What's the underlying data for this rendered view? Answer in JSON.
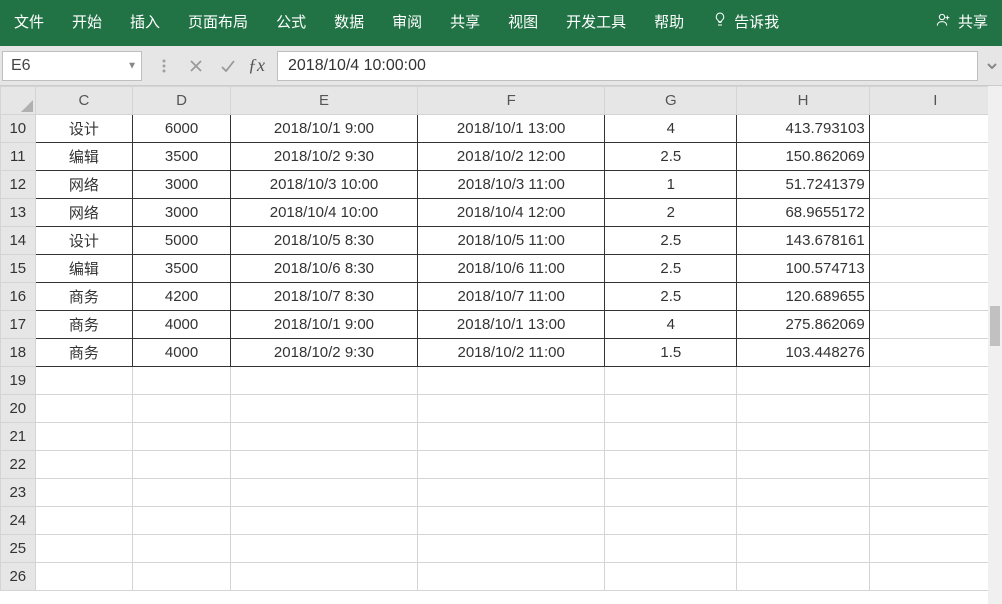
{
  "ribbon": {
    "tabs": [
      "文件",
      "开始",
      "插入",
      "页面布局",
      "公式",
      "数据",
      "审阅",
      "共享",
      "视图",
      "开发工具",
      "帮助"
    ],
    "tell_me": "告诉我",
    "share": "共享"
  },
  "formula_bar": {
    "name_box": "E6",
    "formula": "2018/10/4  10:00:00"
  },
  "columns": [
    "C",
    "D",
    "E",
    "F",
    "G",
    "H",
    "I"
  ],
  "row_start": 10,
  "total_rows": 17,
  "data_rows": 9,
  "cells": {
    "r0": {
      "C": "设计",
      "D": "6000",
      "E": "2018/10/1 9:00",
      "F": "2018/10/1 13:00",
      "G": "4",
      "H": "413.793103"
    },
    "r1": {
      "C": "编辑",
      "D": "3500",
      "E": "2018/10/2 9:30",
      "F": "2018/10/2 12:00",
      "G": "2.5",
      "H": "150.862069"
    },
    "r2": {
      "C": "网络",
      "D": "3000",
      "E": "2018/10/3 10:00",
      "F": "2018/10/3 11:00",
      "G": "1",
      "H": "51.7241379"
    },
    "r3": {
      "C": "网络",
      "D": "3000",
      "E": "2018/10/4 10:00",
      "F": "2018/10/4 12:00",
      "G": "2",
      "H": "68.9655172"
    },
    "r4": {
      "C": "设计",
      "D": "5000",
      "E": "2018/10/5 8:30",
      "F": "2018/10/5 11:00",
      "G": "2.5",
      "H": "143.678161"
    },
    "r5": {
      "C": "编辑",
      "D": "3500",
      "E": "2018/10/6 8:30",
      "F": "2018/10/6 11:00",
      "G": "2.5",
      "H": "100.574713"
    },
    "r6": {
      "C": "商务",
      "D": "4200",
      "E": "2018/10/7 8:30",
      "F": "2018/10/7 11:00",
      "G": "2.5",
      "H": "120.689655"
    },
    "r7": {
      "C": "商务",
      "D": "4000",
      "E": "2018/10/1 9:00",
      "F": "2018/10/1 13:00",
      "G": "4",
      "H": "275.862069"
    },
    "r8": {
      "C": "商务",
      "D": "4000",
      "E": "2018/10/2 9:30",
      "F": "2018/10/2 11:00",
      "G": "1.5",
      "H": "103.448276"
    }
  },
  "col_widths": {
    "row": 34,
    "C": 96,
    "D": 96,
    "E": 184,
    "F": 184,
    "G": 130,
    "H": 130,
    "I": 130
  }
}
